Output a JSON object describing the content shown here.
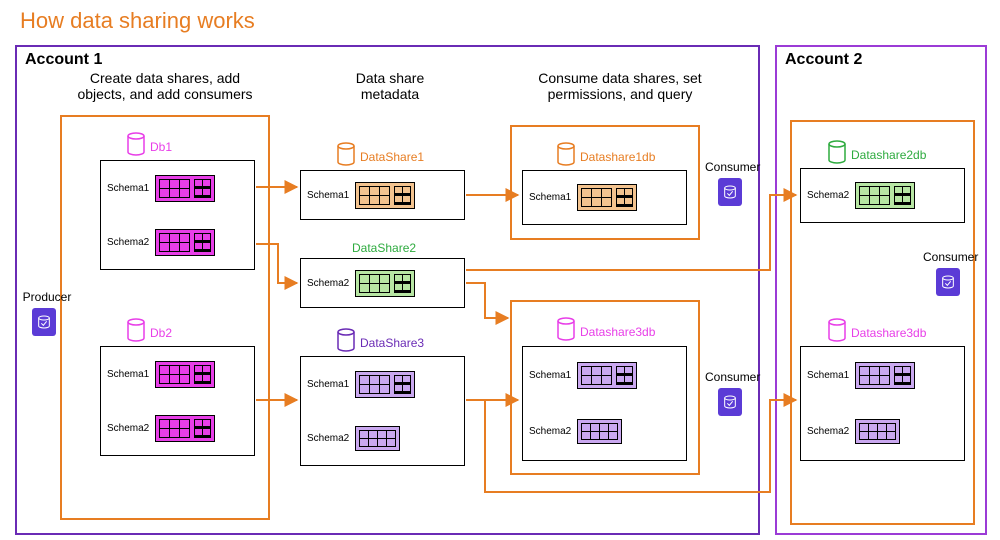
{
  "title": "How data sharing works",
  "accounts": {
    "a1": {
      "label": "Account 1",
      "color": "#6a2bb5"
    },
    "a2": {
      "label": "Account 2",
      "color": "#9b3bd6"
    }
  },
  "columns": {
    "produce": "Create data shares, add\nobjects, and add consumers",
    "meta": "Data share\nmetadata",
    "consume": "Consume data shares, set\npermissions, and query"
  },
  "roles": {
    "producer": "Producer",
    "consumer": "Consumer"
  },
  "dbs": {
    "db1": {
      "name": "Db1",
      "color": "#e83ee8",
      "schemas": [
        "Schema1",
        "Schema2"
      ]
    },
    "db2": {
      "name": "Db2",
      "color": "#e83ee8",
      "schemas": [
        "Schema1",
        "Schema2"
      ]
    }
  },
  "datashares": {
    "ds1": {
      "name": "DataShare1",
      "color": "#e77d22",
      "bg": "orange",
      "schemas": [
        "Schema1"
      ]
    },
    "ds2": {
      "name": "DataShare2",
      "color": "#2eab3f",
      "bg": "green",
      "schemas": [
        "Schema2"
      ]
    },
    "ds3": {
      "name": "DataShare3",
      "color": "#6a2bb5",
      "bg": "purple",
      "schemas": [
        "Schema1",
        "Schema2"
      ]
    }
  },
  "consumer_dbs": {
    "c1": {
      "name": "Datashare1db",
      "color": "#e77d22",
      "bg": "orange",
      "schemas": [
        "Schema1"
      ]
    },
    "c2": {
      "name": "Datashare2db",
      "color": "#2eab3f",
      "bg": "green",
      "schemas": [
        "Schema2"
      ]
    },
    "c3": {
      "name": "Datashare3db",
      "color": "#e83ee8",
      "bg": "purple",
      "schemas": [
        "Schema1",
        "Schema2"
      ]
    },
    "c4": {
      "name": "Datashare3db",
      "color": "#e83ee8",
      "bg": "purple",
      "schemas": [
        "Schema1",
        "Schema2"
      ]
    }
  },
  "arrows": [
    {
      "from": "db1.s1",
      "to": "ds1"
    },
    {
      "from": "db1.s2",
      "to": "ds2"
    },
    {
      "from": "db2",
      "to": "ds3"
    },
    {
      "from": "ds1",
      "to": "c1"
    },
    {
      "from": "ds2",
      "to": "c2"
    },
    {
      "from": "ds2",
      "to": "c3.head"
    },
    {
      "from": "ds3",
      "to": "c3"
    },
    {
      "from": "ds3",
      "to": "c4"
    }
  ],
  "colors": {
    "orange": "#e77d22",
    "purpleAcc1": "#6a2bb5",
    "purpleAcc2": "#9b3bd6",
    "pink": "#e83ee8",
    "green": "#2eab3f",
    "lavender": "#caa8f0",
    "mint": "#b7e6a3",
    "peach": "#f3c38f",
    "cube": "#5b3bd6"
  }
}
